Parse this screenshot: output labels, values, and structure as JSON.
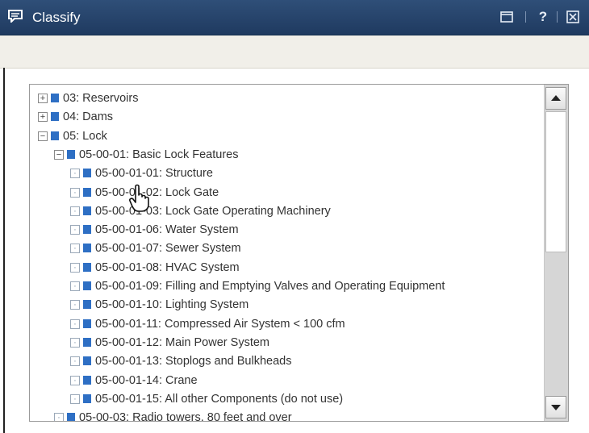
{
  "window": {
    "title": "Classify",
    "icons": [
      "chat-icon",
      "restore-icon",
      "help-icon",
      "close-icon"
    ],
    "help_glyph": "?"
  },
  "tree": {
    "nodes": [
      {
        "label": "03: Reservoirs",
        "state": "collapsed"
      },
      {
        "label": "04: Dams",
        "state": "collapsed"
      },
      {
        "label": "05: Lock",
        "state": "expanded"
      },
      {
        "label": "05-00-01: Basic Lock Features",
        "state": "expanded"
      },
      {
        "label": "05-00-01-01: Structure",
        "state": "leaf"
      },
      {
        "label": "05-00-01-02: Lock Gate",
        "state": "leaf"
      },
      {
        "label": "05-00-01-03: Lock Gate Operating Machinery",
        "state": "leaf"
      },
      {
        "label": "05-00-01-06: Water System",
        "state": "leaf"
      },
      {
        "label": "05-00-01-07: Sewer System",
        "state": "leaf"
      },
      {
        "label": "05-00-01-08: HVAC System",
        "state": "leaf"
      },
      {
        "label": "05-00-01-09: Filling and Emptying Valves and Operating Equipment",
        "state": "leaf"
      },
      {
        "label": "05-00-01-10: Lighting System",
        "state": "leaf"
      },
      {
        "label": "05-00-01-11: Compressed Air System < 100 cfm",
        "state": "leaf"
      },
      {
        "label": "05-00-01-12: Main Power System",
        "state": "leaf"
      },
      {
        "label": "05-00-01-13: Stoplogs and Bulkheads",
        "state": "leaf"
      },
      {
        "label": "05-00-01-14: Crane",
        "state": "leaf"
      },
      {
        "label": "05-00-01-15: All other Components (do not use)",
        "state": "leaf"
      },
      {
        "label": "05-00-03: Radio towers, 80 feet and over",
        "state": "leaf"
      }
    ],
    "toggle_glyphs": {
      "collapsed": "+",
      "expanded": "−",
      "leaf": "·"
    },
    "node_color": "#2e6fc4"
  },
  "colors": {
    "titlebar": "#1f3a60",
    "toolbar": "#f1efe9",
    "node_square": "#2e6fc4"
  }
}
